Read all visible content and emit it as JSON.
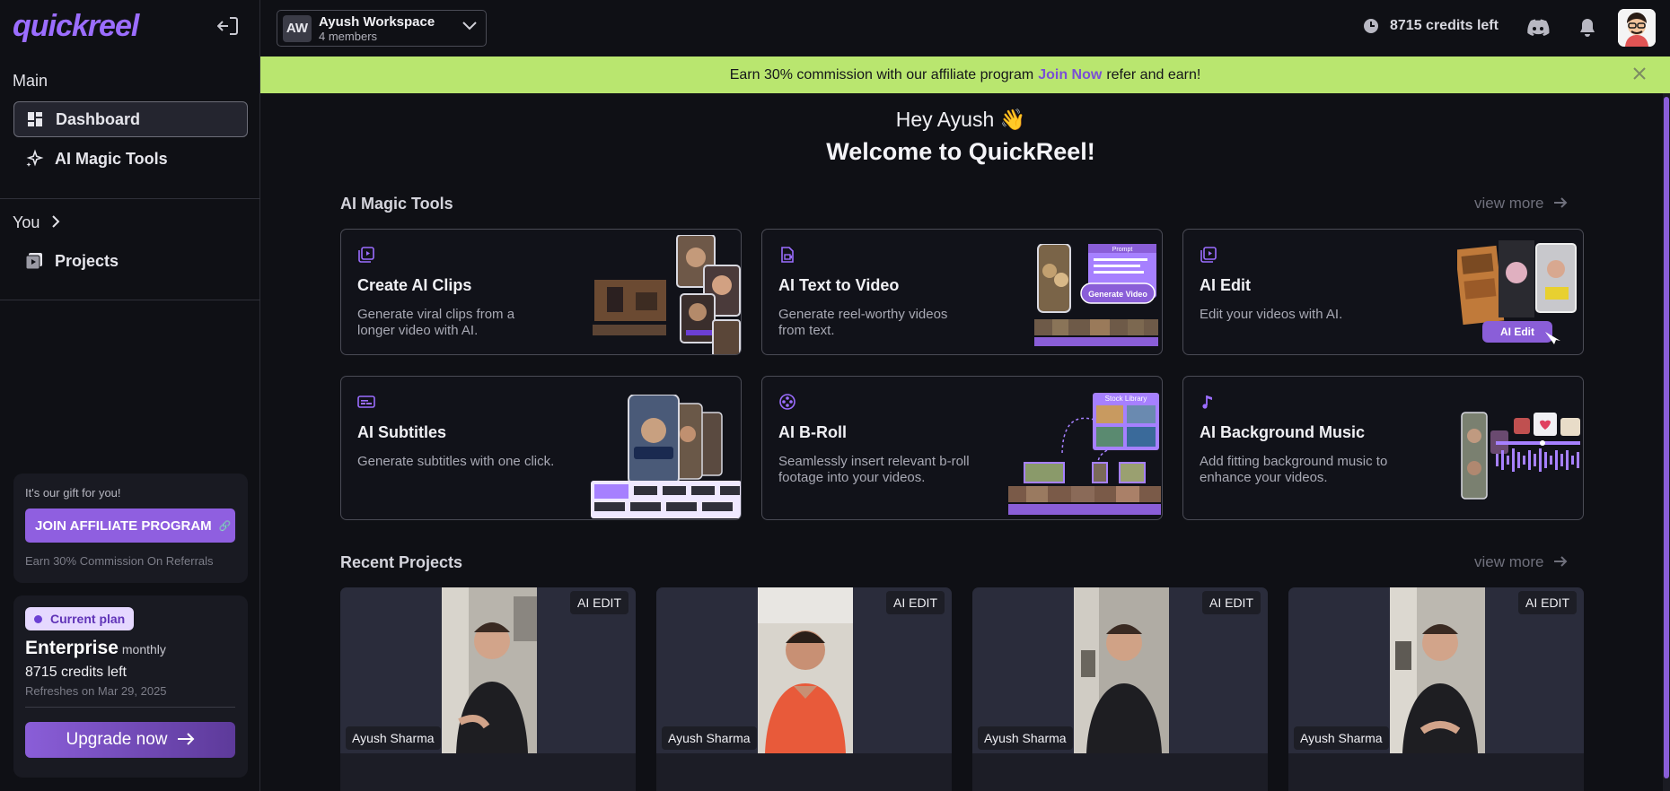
{
  "sidebar": {
    "logo": "quickreel",
    "section_main": "Main",
    "items": [
      {
        "label": "Dashboard"
      },
      {
        "label": "AI Magic Tools"
      }
    ],
    "section_you": "You",
    "you_items": [
      {
        "label": "Projects"
      }
    ],
    "gift": {
      "title": "It's our gift for you!",
      "button": "JOIN AFFILIATE PROGRAM",
      "note": "Earn 30% Commission On Referrals"
    },
    "plan": {
      "badge": "Current plan",
      "name": "Enterprise",
      "cycle": "monthly",
      "credits": "8715 credits left",
      "refresh": "Refreshes on Mar 29, 2025",
      "upgrade": "Upgrade now"
    }
  },
  "header": {
    "workspace_initials": "AW",
    "workspace_name": "Ayush Workspace",
    "workspace_members": "4 members",
    "credits": "8715 credits left"
  },
  "banner": {
    "text_before": "Earn 30% commission with our affiliate program",
    "link": "Join Now",
    "text_after": "refer and earn!"
  },
  "main": {
    "greeting": "Hey Ayush 👋",
    "welcome": "Welcome to QuickReel!",
    "tools_title": "AI Magic Tools",
    "view_more": "view more",
    "tools": [
      {
        "title": "Create AI Clips",
        "desc": "Generate viral clips from a longer video with AI."
      },
      {
        "title": "AI Text to Video",
        "desc": "Generate reel-worthy videos from text."
      },
      {
        "title": "AI Edit",
        "desc": "Edit your videos with AI."
      },
      {
        "title": "AI Subtitles",
        "desc": "Generate subtitles with one click."
      },
      {
        "title": "AI B-Roll",
        "desc": "Seamlessly insert relevant b-roll footage into your videos."
      },
      {
        "title": "AI Background Music",
        "desc": "Add fitting background music to enhance your videos."
      }
    ],
    "art_labels": {
      "generate_video": "Generate Video",
      "prompt": "Prompt",
      "ai_edit": "AI Edit",
      "stock_library": "Stock Library"
    },
    "recent_title": "Recent Projects",
    "projects": [
      {
        "badge": "AI EDIT",
        "owner": "Ayush Sharma"
      },
      {
        "badge": "AI EDIT",
        "owner": "Ayush Sharma"
      },
      {
        "badge": "AI EDIT",
        "owner": "Ayush Sharma"
      },
      {
        "badge": "AI EDIT",
        "owner": "Ayush Sharma"
      }
    ]
  },
  "colors": {
    "accent": "#8f5fe0",
    "banner": "#b9e66f",
    "background": "#0f1015"
  }
}
